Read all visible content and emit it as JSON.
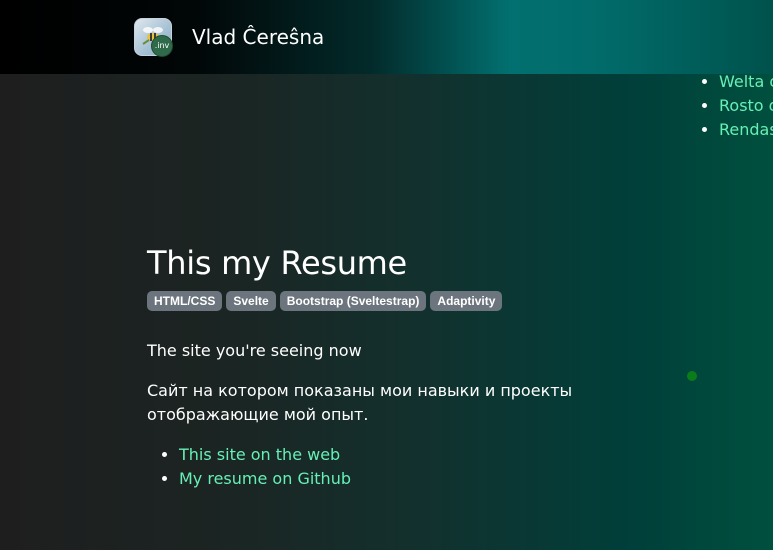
{
  "header": {
    "brand_name": "Vlad Ĉereŝna",
    "logo_badge_text": ".inv",
    "logo_icon": "bee-app-icon",
    "gradient_colors": [
      "#000000",
      "#027070",
      "#00524c"
    ]
  },
  "side_list": {
    "items": [
      {
        "label": "Welta o"
      },
      {
        "label": "Rosto o"
      },
      {
        "label": "Rendas"
      }
    ]
  },
  "project": {
    "title": "This my Resume",
    "tags": [
      "HTML/CSS",
      "Svelte",
      "Bootstrap (Sveltestrap)",
      "Adaptivity"
    ],
    "description": "The site you're seeing now",
    "description_ru": "Сайт на котором показаны мои навыки и проекты отображающие мой опыт.",
    "links": [
      {
        "label": "This site on the web"
      },
      {
        "label": "My resume on Github"
      }
    ]
  },
  "colors": {
    "link": "#67f0b6",
    "tag_bg": "#6c757d",
    "indicator": "#0a7d1a"
  }
}
